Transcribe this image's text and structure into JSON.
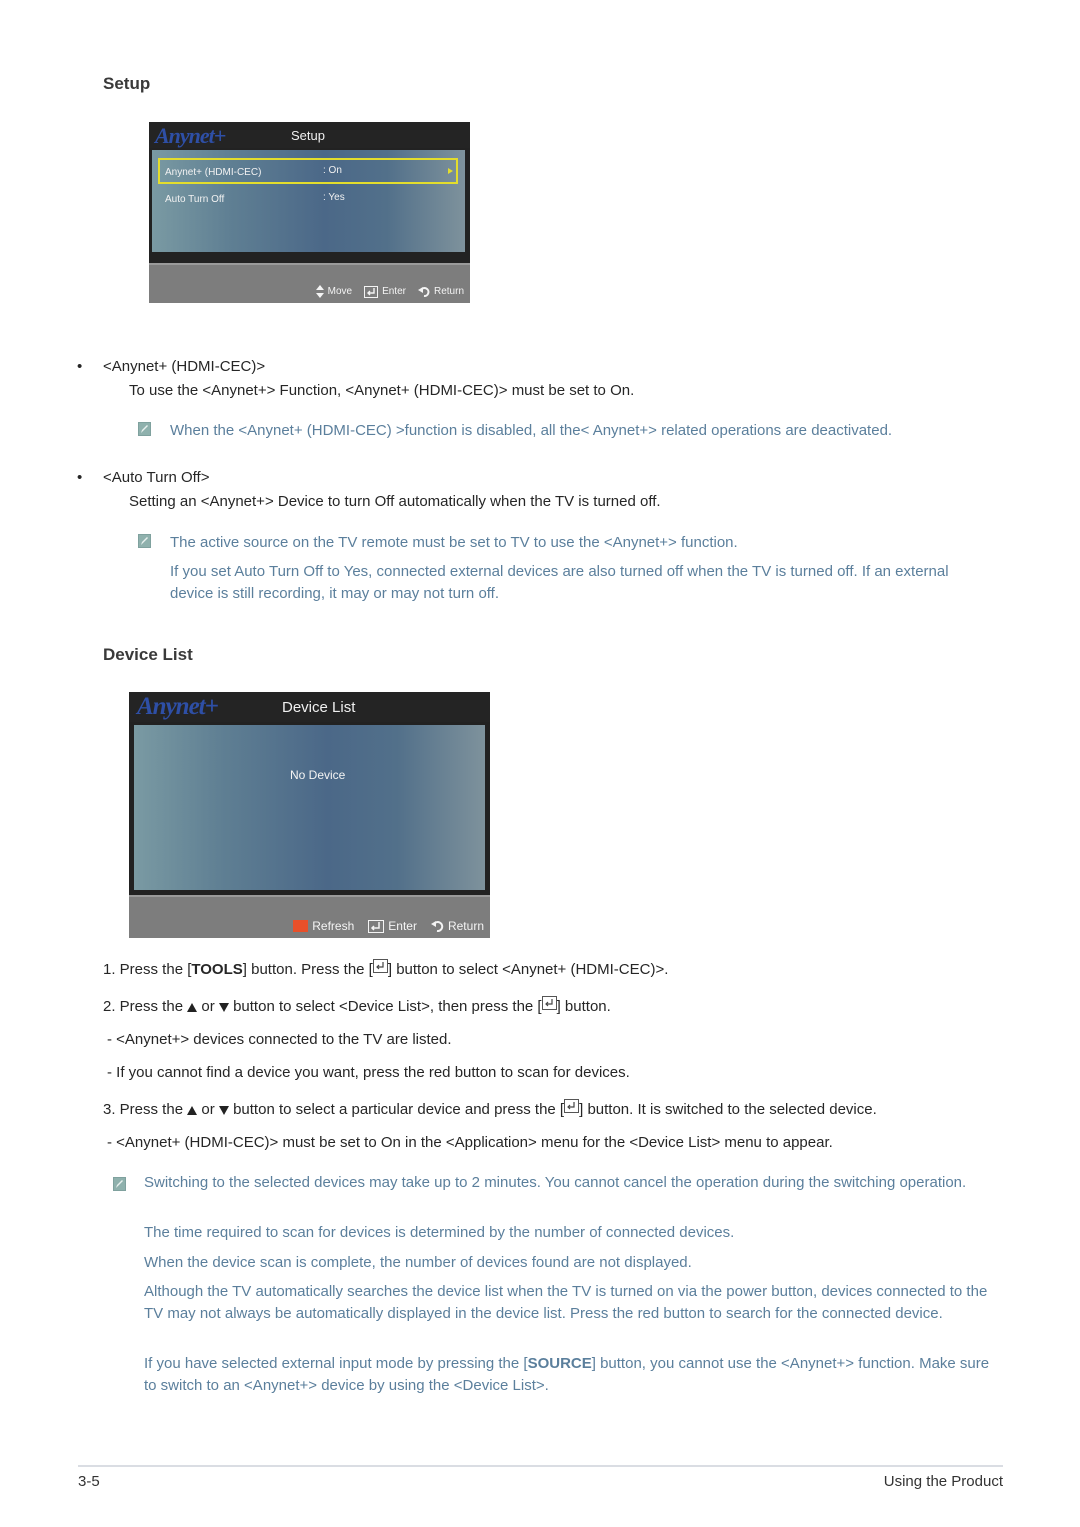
{
  "sections": {
    "setup": {
      "heading": "Setup",
      "osd": {
        "logo": "Anynet+",
        "title": "Setup",
        "rows": [
          {
            "label": "Anynet+ (HDMI-CEC)",
            "value": ": On",
            "selected": true
          },
          {
            "label": "Auto Turn Off",
            "value": ": Yes",
            "selected": false
          }
        ],
        "footer": {
          "move": "Move",
          "enter": "Enter",
          "return": "Return"
        }
      },
      "items": [
        {
          "bullet": "•",
          "title": "<Anynet+ (HDMI-CEC)>",
          "desc": "To use the <Anynet+> Function, <Anynet+ (HDMI-CEC)> must be set to On.",
          "notes": [
            "When the <Anynet+ (HDMI-CEC) >function is disabled, all the< Anynet+> related operations are deactivated."
          ]
        },
        {
          "bullet": "•",
          "title": "<Auto Turn Off>",
          "desc": "Setting an <Anynet+> Device to turn Off automatically when the TV is turned off.",
          "notes": [
            "The active source on the TV remote must be set to TV to use the <Anynet+> function.",
            "If you set Auto Turn Off to Yes, connected external devices are also turned off when the TV is turned off. If an external device is still recording, it may or may not turn off."
          ]
        }
      ]
    },
    "device_list": {
      "heading": "Device List",
      "osd": {
        "logo": "Anynet+",
        "title": "Device List",
        "message": "No Device",
        "footer": {
          "refresh": "Refresh",
          "enter": "Enter",
          "return": "Return"
        },
        "refresh_color": "#e8502a"
      },
      "steps": {
        "s1_a": "1. Press the [",
        "s1_tools": "TOOLS",
        "s1_b": "] button. Press the [",
        "s1_c": "] button to select <Anynet+ (HDMI-CEC)>.",
        "s2_a": "2. Press the",
        "s2_or": "or",
        "s2_b": "button to select <Device List>, then press the [",
        "s2_c": "] button.",
        "d1": "- <Anynet+> devices connected to the TV are listed.",
        "d2": "- If you cannot find a device you want, press the red button to scan for devices.",
        "s3_a": "3. Press the",
        "s3_or": "or",
        "s3_b": "button to select a particular device and press the [",
        "s3_c": "] button. It is switched to the selected device.",
        "d3": "- <Anynet+ (HDMI-CEC)> must be set to On in the <Application> menu for the <Device List> menu to appear."
      },
      "notes": {
        "n1": "Switching to the selected devices may take up to 2 minutes. You cannot cancel the operation during the switching operation.",
        "n2": "The time required to scan for devices is determined by the number of connected devices.",
        "n3": "When the device scan is complete, the number of devices found are not displayed.",
        "n4": "Although the TV automatically searches the device list when the TV is turned on via the power button, devices connected to the TV may not always be automatically displayed in the device list. Press the red button to search for the connected device.",
        "n5_a": "If you have selected external input mode by pressing the [",
        "n5_source": "SOURCE",
        "n5_b": "] button, you cannot use the <Anynet+> function. Make sure to switch to an <Anynet+> device by using the <Device List>."
      }
    }
  },
  "footer": {
    "page_number": "3-5",
    "chapter": "Using the Product"
  },
  "colors": {
    "note_text": "#5b7f9c",
    "selection_border": "#e3dd2c",
    "osd_logo": "#2e4fa6"
  }
}
